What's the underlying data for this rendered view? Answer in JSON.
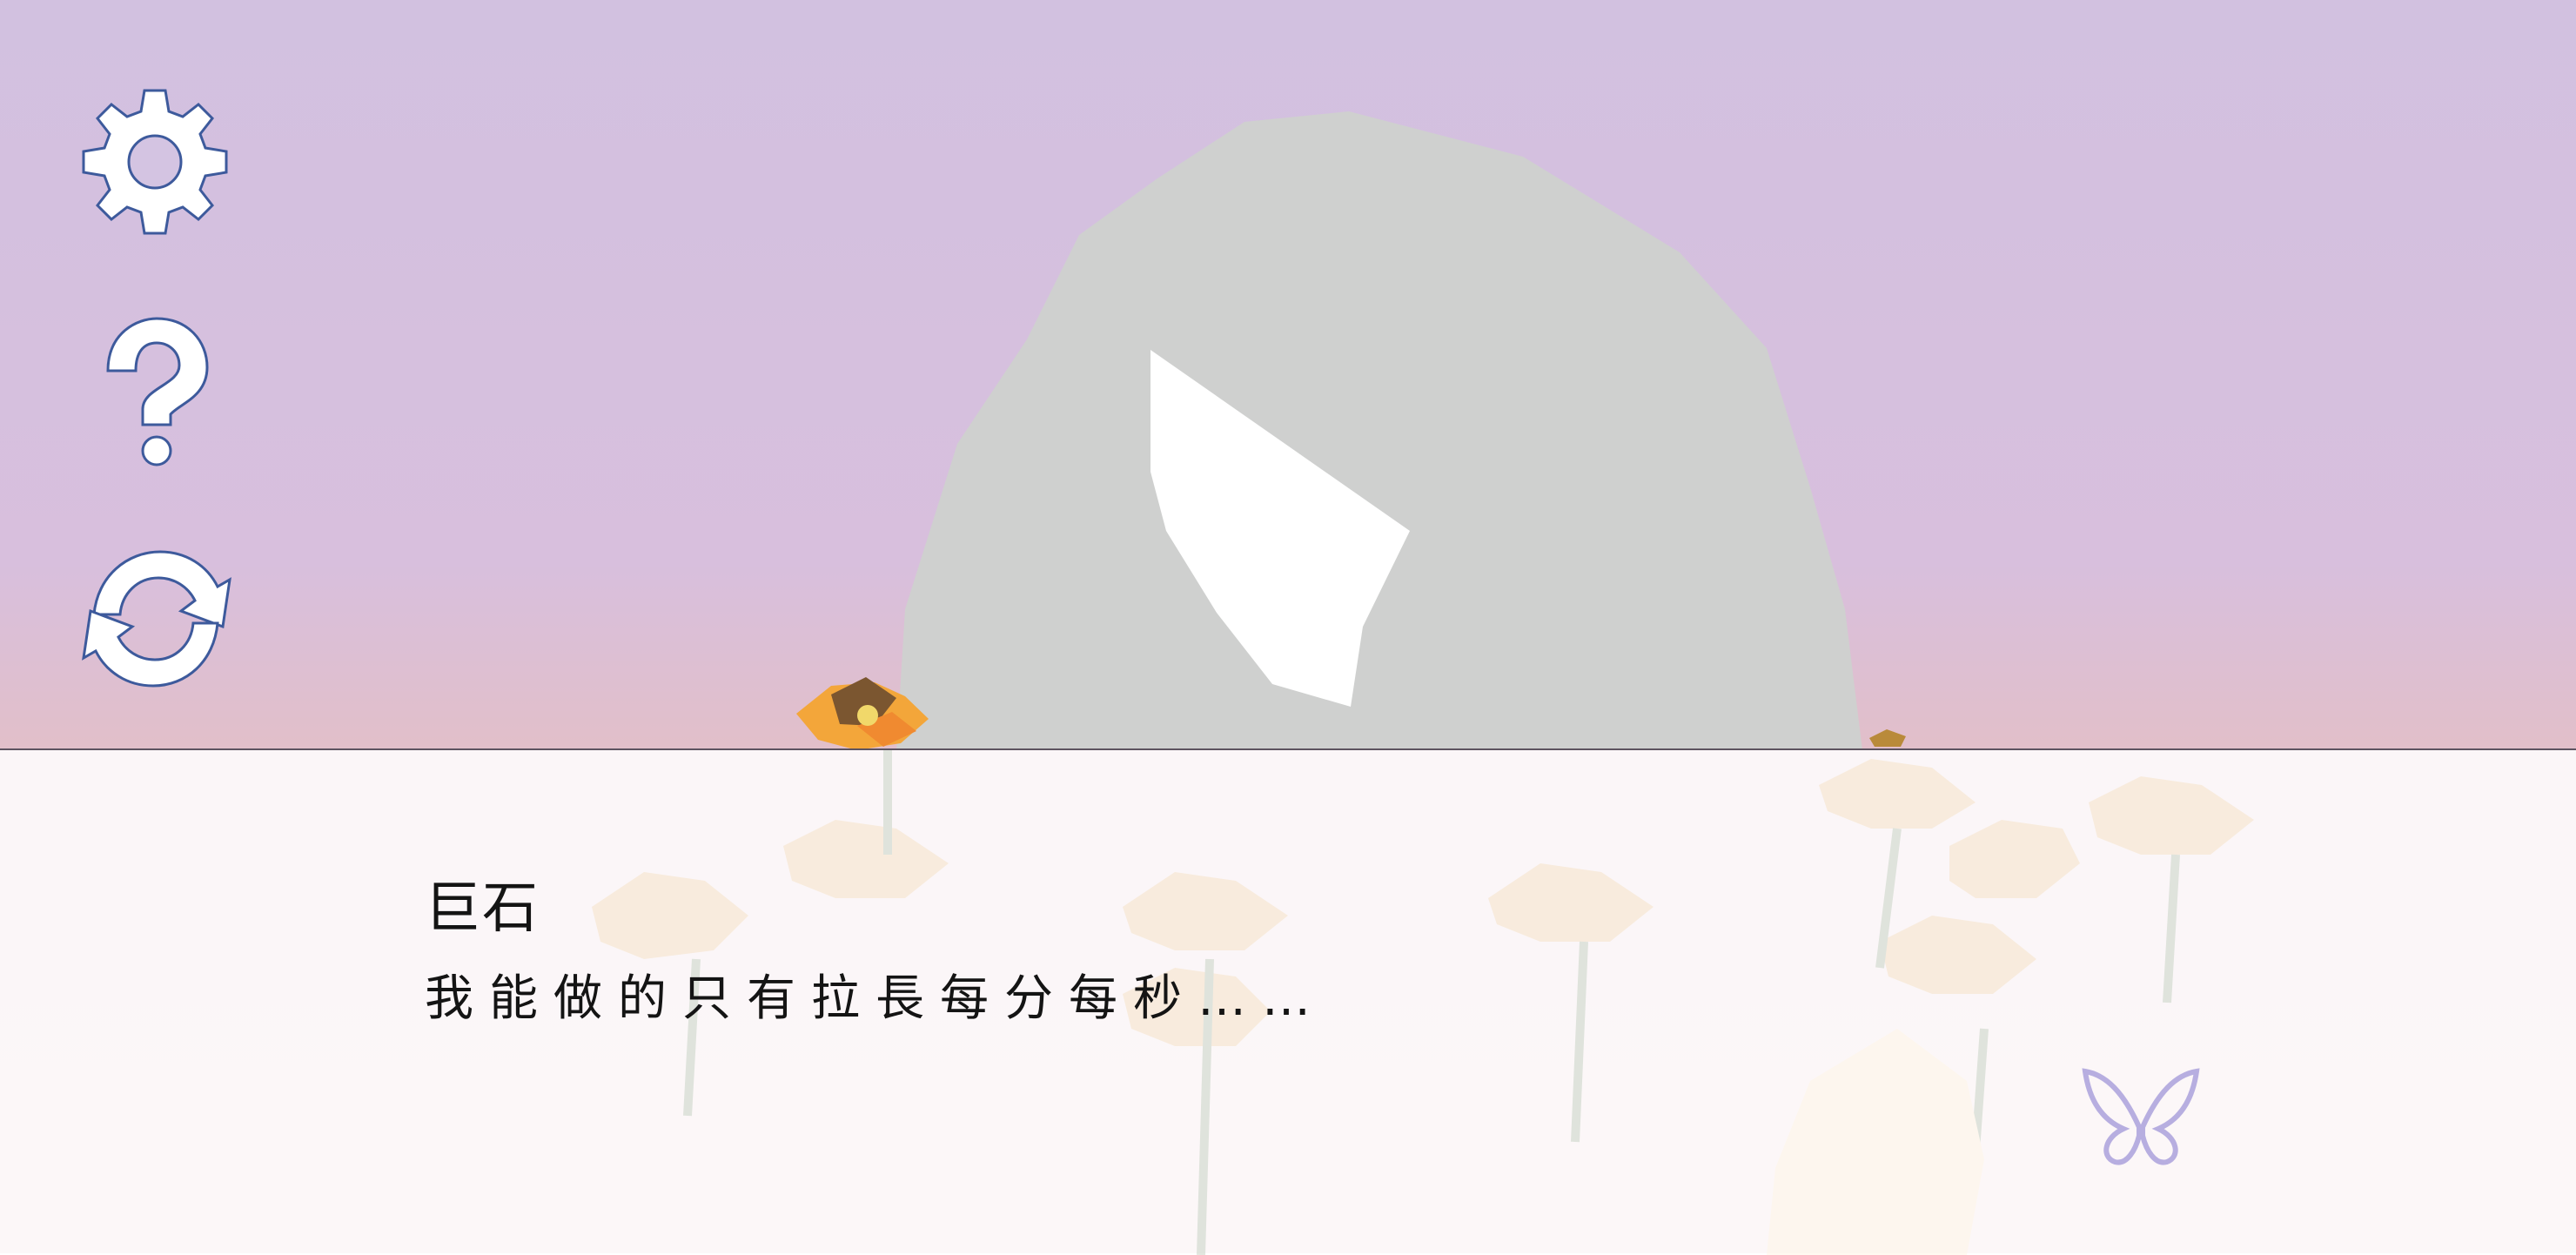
{
  "hud": {
    "settings_icon": "gear-icon",
    "help_icon": "question-mark-icon",
    "restart_icon": "restart-arrows-icon",
    "icon_fill": "#ffffff",
    "icon_outline": "#3d5a9c"
  },
  "scene": {
    "sky_top": "#d2c1e0",
    "sky_bottom": "#e6c4c9",
    "boulder_color": "#cfd0cf",
    "flower_color": "#f4b340"
  },
  "dialog": {
    "speaker": "巨石",
    "line": "我能做的只有拉長每分每秒……"
  },
  "indicators": {
    "continue_icon": "butterfly-icon"
  }
}
